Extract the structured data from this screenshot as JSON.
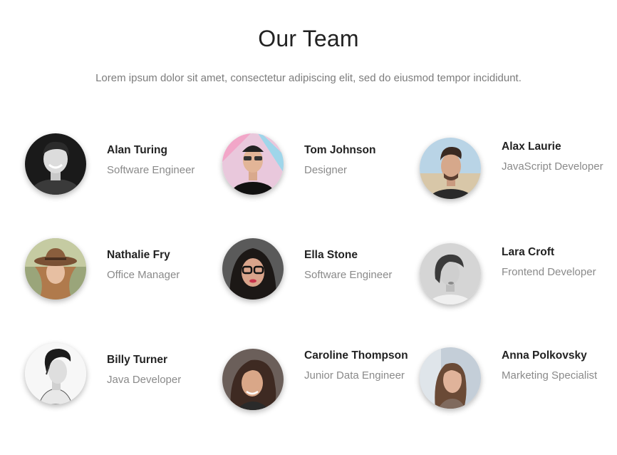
{
  "header": {
    "title": "Our Team",
    "subtitle": "Lorem ipsum dolor sit amet, consectetur adipiscing elit, sed do eiusmod tempor incididunt."
  },
  "members": [
    {
      "name": "Alan Turing",
      "role": "Software Engineer"
    },
    {
      "name": "Tom Johnson",
      "role": "Designer"
    },
    {
      "name": "Alax Laurie",
      "role": "JavaScript Developer"
    },
    {
      "name": "Nathalie Fry",
      "role": "Office Manager"
    },
    {
      "name": "Ella Stone",
      "role": "Software Engineer"
    },
    {
      "name": "Lara Croft",
      "role": "Frontend Developer"
    },
    {
      "name": "Billy Turner",
      "role": "Java Developer"
    },
    {
      "name": "Caroline Thompson",
      "role": "Junior Data Engineer"
    },
    {
      "name": "Anna Polkovsky",
      "role": "Marketing Specialist"
    }
  ]
}
